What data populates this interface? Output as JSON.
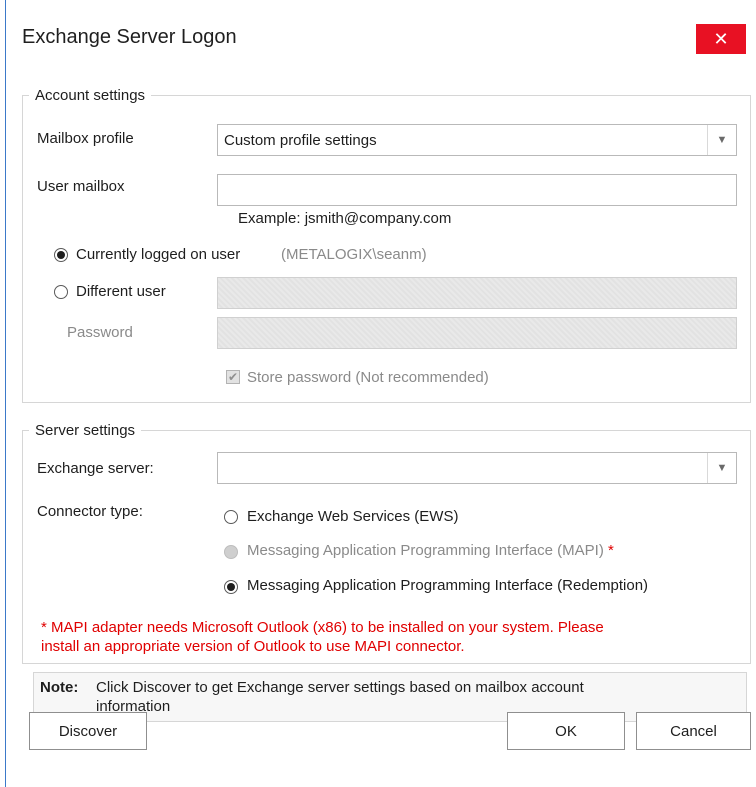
{
  "dialog": {
    "title": "Exchange Server Logon",
    "close_symbol": "✕"
  },
  "account_settings": {
    "legend": "Account settings",
    "mailbox_profile_label": "Mailbox profile",
    "mailbox_profile_value": "Custom profile settings",
    "user_mailbox_label": "User mailbox",
    "user_mailbox_value": "",
    "example_text": "Example: jsmith@company.com",
    "current_user_label": "Currently logged on user",
    "current_user_value": "(METALOGIX\\seanm)",
    "different_user_label": "Different user",
    "password_label": "Password",
    "store_password_label": "Store password (Not recommended)",
    "selected_user_option": "Currently logged on user",
    "store_password_checked": true
  },
  "server_settings": {
    "legend": "Server settings",
    "exchange_server_label": "Exchange server:",
    "exchange_server_value": "",
    "connector_type_label": "Connector type:",
    "connectors": [
      {
        "label": "Exchange Web Services (EWS)",
        "selected": false,
        "disabled": false
      },
      {
        "label": "Messaging Application Programming Interface (MAPI)",
        "selected": false,
        "disabled": true
      },
      {
        "label": "Messaging Application Programming Interface (Redemption)",
        "selected": true,
        "disabled": false
      }
    ],
    "mapi_asterisk": "*",
    "warning_line1": "* MAPI adapter needs Microsoft Outlook (x86) to be installed on your system. Please",
    "warning_line2": "install an appropriate version of Outlook to use MAPI connector."
  },
  "note": {
    "label": "Note:",
    "line1": "Click Discover to get Exchange server settings based on mailbox account",
    "line2": "information"
  },
  "buttons": {
    "discover": "Discover",
    "ok": "OK",
    "cancel": "Cancel"
  },
  "icons": {
    "close": "close-icon",
    "dropdown": "chevron-down-icon",
    "check": "checkmark-icon"
  },
  "colors": {
    "close_button": "#e81123",
    "warning_text": "#e00000",
    "window_border": "#3b79c9"
  }
}
